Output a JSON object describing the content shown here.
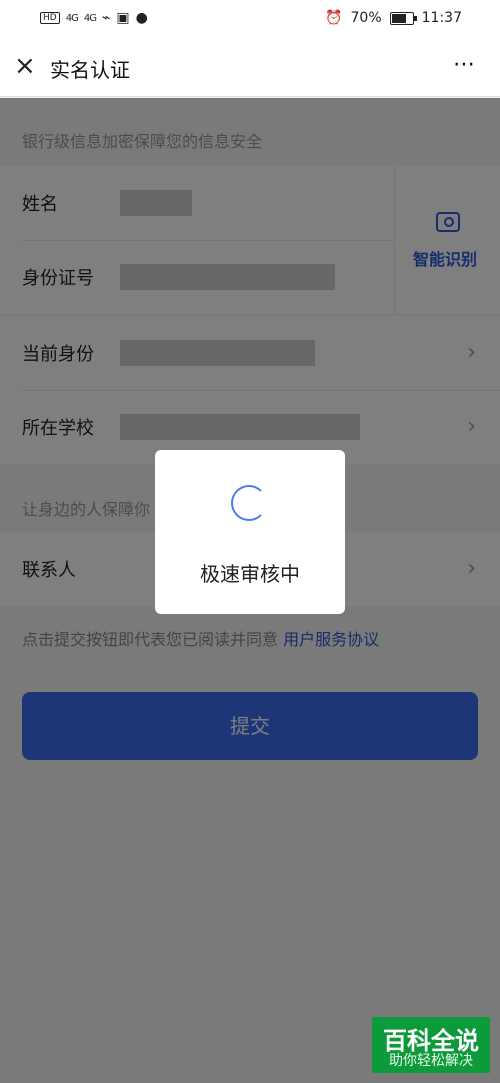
{
  "status_bar": {
    "left": [
      "HD",
      "4G",
      "4G"
    ],
    "battery_percent": "70%",
    "time": "11:37"
  },
  "header": {
    "title": "实名认证",
    "more": "⋯"
  },
  "form": {
    "hint_top": "银行级信息加密保障您的信息安全",
    "rows": [
      {
        "label": "姓名"
      },
      {
        "label": "身份证号"
      },
      {
        "label": "当前身份"
      },
      {
        "label": "所在学校"
      }
    ],
    "ocr_label": "智能识别",
    "hint_mid": "让身边的人保障你",
    "contact_label": "联系人",
    "agree_prefix": "点击提交按钮即代表您已阅读并同意",
    "agree_link": "用户服务协议",
    "submit_label": "提交"
  },
  "dialog": {
    "text": "极速审核中"
  },
  "watermark": {
    "top": "百科全说",
    "bottom": "助你轻松解决"
  },
  "icons": {
    "close": "×",
    "chevron": "›"
  },
  "colors": {
    "accent": "#2b5bd6",
    "submit": "#3a6cf0"
  }
}
